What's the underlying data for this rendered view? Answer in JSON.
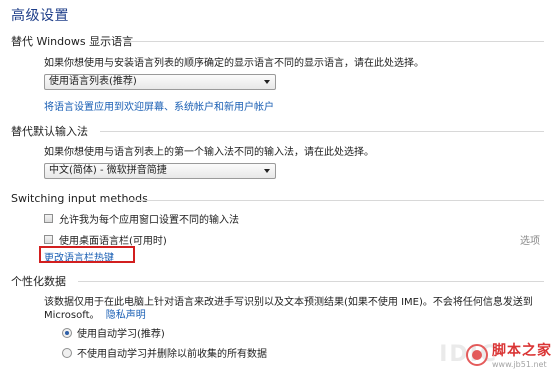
{
  "title": "高级设置",
  "sections": {
    "display_language": {
      "header": "替代 Windows 显示语言",
      "description": "如果你想使用与安装语言列表的顺序确定的显示语言不同的显示语言，请在此处选择。",
      "select_value": "使用语言列表(推荐)",
      "link": "将语言设置应用到欢迎屏幕、系统帐户和新用户帐户"
    },
    "input_method": {
      "header": "替代默认输入法",
      "description": "如果你想使用与语言列表上的第一个输入法不同的输入法，请在此处选择。",
      "select_value": "中文(简体) - 微软拼音简捷"
    },
    "switching": {
      "header": "Switching input methods",
      "checkbox1": "允许我为每个应用窗口设置不同的输入法",
      "checkbox2": "使用桌面语言栏(可用时)",
      "options_link": "选项",
      "hotkey_link": "更改语言栏热键"
    },
    "personalization": {
      "header": "个性化数据",
      "description_line1": "该数据仅用于在此电脑上针对语言来改进手写识别以及文本预测结果(如果不使用 IME)。不会将任何信息发送到",
      "description_line2": "Microsoft。",
      "privacy_link": "隐私声明",
      "radio1": "使用自动学习(推荐)",
      "radio2": "不使用自动学习并删除以前收集的所有数据"
    }
  },
  "watermark": {
    "main": "脚本之家",
    "sub": "www.jb51.net",
    "bg": "IDIC"
  },
  "colors": {
    "title": "#1f3f8a",
    "link": "#1a5fb4",
    "highlight": "#d21f1f"
  }
}
